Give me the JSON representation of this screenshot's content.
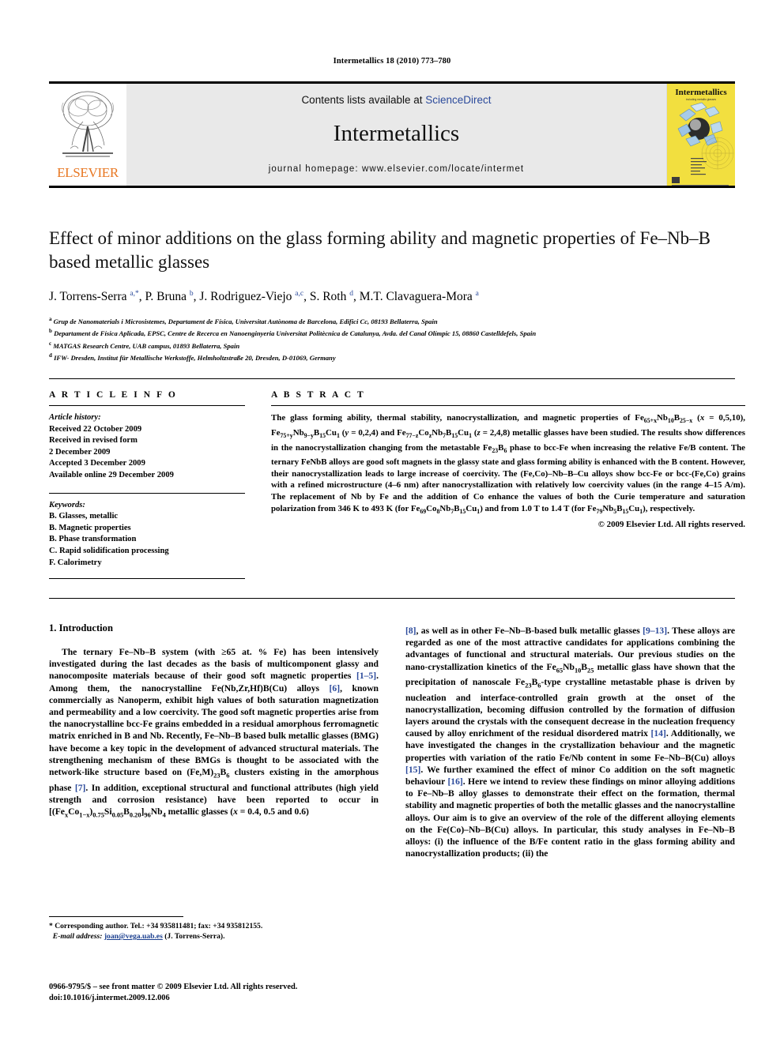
{
  "running_head": "Intermetallics 18 (2010) 773–780",
  "masthead": {
    "publisher": "ELSEVIER",
    "contents_prefix": "Contents lists available at ",
    "contents_link": "ScienceDirect",
    "journal_name": "Intermetallics",
    "homepage": "journal homepage: www.elsevier.com/locate/intermet",
    "cover_title": "Intermetallics",
    "cover_subtitle": "including metallic glasses"
  },
  "article": {
    "title": "Effect of minor additions on the glass forming ability and magnetic properties of Fe–Nb–B based metallic glasses",
    "authors_html": "J. Torrens-Serra <sup>a,*</sup>, P. Bruna <sup>b</sup>, J. Rodriguez-Viejo <sup>a,c</sup>, S. Roth <sup>d</sup>, M.T. Clavaguera-Mora <sup>a</sup>",
    "affiliations": [
      {
        "marker": "a",
        "text": "Grup de Nanomaterials i Microsistemes, Departament de Física, Universitat Autònoma de Barcelona, Edifici Cc, 08193 Bellaterra, Spain"
      },
      {
        "marker": "b",
        "text": "Departament de Física Aplicada, EPSC, Centre de Recerca en Nanoenginyeria Universitat Politècnica de Catalunya, Avda. del Canal Olímpic 15, 08860 Castelldefels, Spain"
      },
      {
        "marker": "c",
        "text": "MATGAS Research Centre, UAB campus, 01893 Bellaterra, Spain"
      },
      {
        "marker": "d",
        "text": "IFW- Dresden, Institut für Metallische Werkstoffe, Helmholtzstraße 20, Dresden, D-01069, Germany"
      }
    ]
  },
  "info": {
    "heading": "A R T I C L E   I N F O",
    "history_label": "Article history:",
    "history": [
      "Received 22 October 2009",
      "Received in revised form",
      "2 December 2009",
      "Accepted 3 December 2009",
      "Available online 29 December 2009"
    ],
    "keywords_label": "Keywords:",
    "keywords": [
      "B. Glasses, metallic",
      "B. Magnetic properties",
      "B. Phase transformation",
      "C. Rapid solidification processing",
      "F. Calorimetry"
    ]
  },
  "abstract": {
    "heading": "A B S T R A C T",
    "body_html": "The glass forming ability, thermal stability, nanocrystallization, and magnetic properties of Fe<sub>65+x</sub>Nb<sub>10</sub>B<sub>25&minus;x</sub> (<i>x</i> = 0,5,10), Fe<sub>75+y</sub>Nb<sub>9&minus;y</sub>B<sub>15</sub>Cu<sub>1</sub> (<i>y</i> = 0,2,4) and Fe<sub>77&minus;z</sub>Co<sub>z</sub>Nb<sub>7</sub>B<sub>15</sub>Cu<sub>1</sub> (<i>z</i> = 2,4,8) metallic glasses have been studied. The results show differences in the nanocrystallization changing from the metastable Fe<sub>23</sub>B<sub>6</sub> phase to bcc-Fe when increasing the relative Fe/B content. The ternary FeNbB alloys are good soft magnets in the glassy state and glass forming ability is enhanced with the B content. However, their nanocrystallization leads to large increase of coercivity. The (Fe,Co)–Nb–B–Cu alloys show bcc-Fe or bcc-(Fe,Co) grains with a refined microstructure (4–6 nm) after nanocrystallization with relatively low coercivity values (in the range 4–15 A/m). The replacement of Nb by Fe and the addition of Co enhance the values of both the Curie temperature and saturation polarization from 346 K to 493 K (for Fe<sub>69</sub>Co<sub>8</sub>Nb<sub>7</sub>B<sub>15</sub>Cu<sub>1</sub>) and from 1.0 T to 1.4 T (for Fe<sub>79</sub>Nb<sub>5</sub>B<sub>15</sub>Cu<sub>1</sub>), respectively.",
    "copyright": "© 2009 Elsevier Ltd. All rights reserved."
  },
  "section": {
    "number_title": "1.  Introduction"
  },
  "body": {
    "left_html": "The ternary Fe–Nb–B system (with &ge;65 at. % Fe) has been intensively investigated during the last decades as the basis of multicomponent glassy and nanocomposite materials because of their good soft magnetic properties <span class=\"ref\">[1–5]</span>. Among them, the nanocrystalline Fe(Nb,Zr,Hf)B(Cu) alloys <span class=\"ref\">[6]</span>, known commercially as Nanoperm, exhibit high values of both saturation magnetization and permeability and a low coercivity. The good soft magnetic properties arise from the nanocrystalline bcc-Fe grains embedded in a residual amorphous ferromagnetic matrix enriched in B and Nb. Recently, Fe–Nb–B based bulk metallic glasses (BMG) have become a key topic in the development of advanced structural materials. The strengthening mechanism of these BMGs is thought to be associated with the network-like structure based on (Fe,M)<sub>23</sub>B<sub>6</sub> clusters existing in the amorphous phase <span class=\"ref\">[7]</span>. In addition, exceptional structural and functional attributes (high yield strength and corrosion resistance) have been reported to occur in [(Fe<sub>x</sub>Co<sub>1&minus;x</sub>)<sub>0.75</sub>Si<sub>0.05</sub>B<sub>0.20</sub>]<sub>96</sub>Nb<sub>4</sub> metallic glasses (<i>x</i> = 0.4, 0.5 and 0.6)",
    "right_html": "<span class=\"ref\">[8]</span>, as well as in other Fe–Nb–B-based bulk metallic glasses <span class=\"ref\">[9–13]</span>. These alloys are regarded as one of the most attractive candidates for applications combining the advantages of functional and structural materials. Our previous studies on the nano-crystallization kinetics of the Fe<sub>65</sub>Nb<sub>10</sub>B<sub>25</sub> metallic glass have shown that the precipitation of nanoscale Fe<sub>23</sub>B<sub>6</sub>-type crystalline metastable phase is driven by nucleation and interface-controlled grain growth at the onset of the nanocrystallization, becoming diffusion controlled by the formation of diffusion layers around the crystals with the consequent decrease in the nucleation frequency caused by alloy enrichment of the residual disordered matrix <span class=\"ref\">[14]</span>. Additionally, we have investigated the changes in the crystallization behaviour and the magnetic properties with variation of the ratio Fe/Nb content in some Fe–Nb–B(Cu) alloys <span class=\"ref\">[15]</span>. We further examined the effect of minor Co addition on the soft magnetic behaviour <span class=\"ref\">[16]</span>. Here we intend to review these findings on minor alloying additions to Fe–Nb–B alloy glasses to demonstrate their effect on the formation, thermal stability and magnetic properties of both the metallic glasses and the nanocrystalline alloys. Our aim is to give an overview of the role of the different alloying elements on the Fe(Co)–Nb–B(Cu) alloys. In particular, this study analyses in Fe–Nb–B alloys: (i) the influence of the B/Fe content ratio in the glass forming ability and nanocrystallization products; (ii) the"
  },
  "footnote": {
    "corresponding_html": "* Corresponding author. Tel.: +34 935811481; fax: +34 935812155.",
    "email_label": "E-mail address:",
    "email": "joan@vega.uab.es",
    "email_suffix": "(J. Torrens-Serra)."
  },
  "issn": {
    "line1": "0966-9795/$ – see front matter © 2009 Elsevier Ltd. All rights reserved.",
    "line2": "doi:10.1016/j.intermet.2009.12.006"
  },
  "colors": {
    "link": "#2b4a9b",
    "elsevier_orange": "#e87722",
    "cover_yellow": "#f2df3f",
    "masthead_grey": "#e9e9e9"
  }
}
